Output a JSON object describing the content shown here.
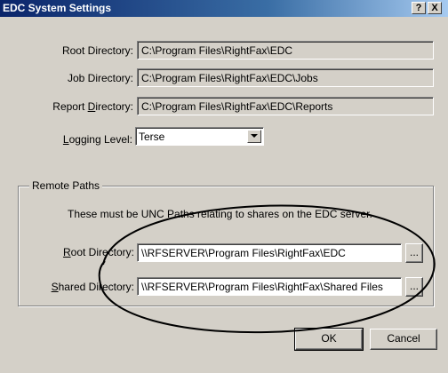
{
  "window": {
    "title": "EDC System Settings",
    "help_label": "?",
    "close_label": "X"
  },
  "fields": [
    {
      "label": "Root Directory:",
      "value": "C:\\Program Files\\RightFax\\EDC"
    },
    {
      "label": "Job Directory:",
      "value": "C:\\Program Files\\RightFax\\EDC\\Jobs"
    },
    {
      "label_pre": "Report ",
      "label_ul": "D",
      "label_post": "irectory:",
      "value": "C:\\Program Files\\RightFax\\EDC\\Reports"
    }
  ],
  "logging": {
    "label_ul": "L",
    "label_post": "ogging Level:",
    "selected": "Terse"
  },
  "remote_paths": {
    "group_title": "Remote Paths",
    "info_text": "These must be UNC Paths relating to shares on the EDC server.",
    "root": {
      "label_ul": "R",
      "label_post": "oot Directory:",
      "value": "\\\\RFSERVER\\Program Files\\RightFax\\EDC",
      "browse_label": "..."
    },
    "shared": {
      "label_ul": "S",
      "label_post": "hared Directory:",
      "value": "\\\\RFSERVER\\Program Files\\RightFax\\Shared Files",
      "browse_label": "..."
    }
  },
  "buttons": {
    "ok_label": "OK",
    "cancel_label": "Cancel"
  }
}
